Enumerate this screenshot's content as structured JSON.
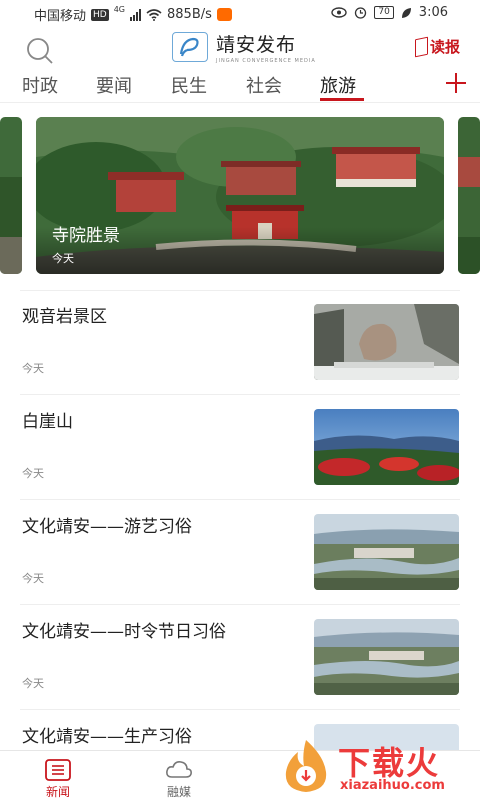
{
  "status_bar": {
    "carrier": "中国移动",
    "hd": "HD",
    "network": "4G",
    "speed": "885B/s",
    "battery": "70",
    "time": "3:06"
  },
  "header": {
    "logo_title": "靖安发布",
    "logo_subtitle": "JINGAN CONVERGENCE MEDIA",
    "read_label": "读报"
  },
  "tabs": [
    {
      "label": "时政",
      "active": false
    },
    {
      "label": "要闻",
      "active": false
    },
    {
      "label": "民生",
      "active": false
    },
    {
      "label": "社会",
      "active": false
    },
    {
      "label": "旅游",
      "active": true
    }
  ],
  "banner": {
    "title": "寺院胜景",
    "date": "今天"
  },
  "articles": [
    {
      "title": "观音岩景区",
      "date": "今天",
      "thumb": "snowy-rock"
    },
    {
      "title": "白崖山",
      "date": "今天",
      "thumb": "mountain-flowers"
    },
    {
      "title": "文化靖安——游艺习俗",
      "date": "今天",
      "thumb": "river-town"
    },
    {
      "title": "文化靖安——时令节日习俗",
      "date": "今天",
      "thumb": "river-town"
    },
    {
      "title": "文化靖安——生产习俗",
      "date": "",
      "thumb": "sky"
    }
  ],
  "bottom_nav": [
    {
      "label": "新闻",
      "icon": "news-list-icon",
      "active": true
    },
    {
      "label": "融媒",
      "icon": "cloud-icon",
      "active": false
    }
  ],
  "watermark": {
    "text": "下载火",
    "url": "xiazaihuo.com"
  },
  "colors": {
    "accent": "#c8161d",
    "watermark": "#ec3b3b"
  }
}
